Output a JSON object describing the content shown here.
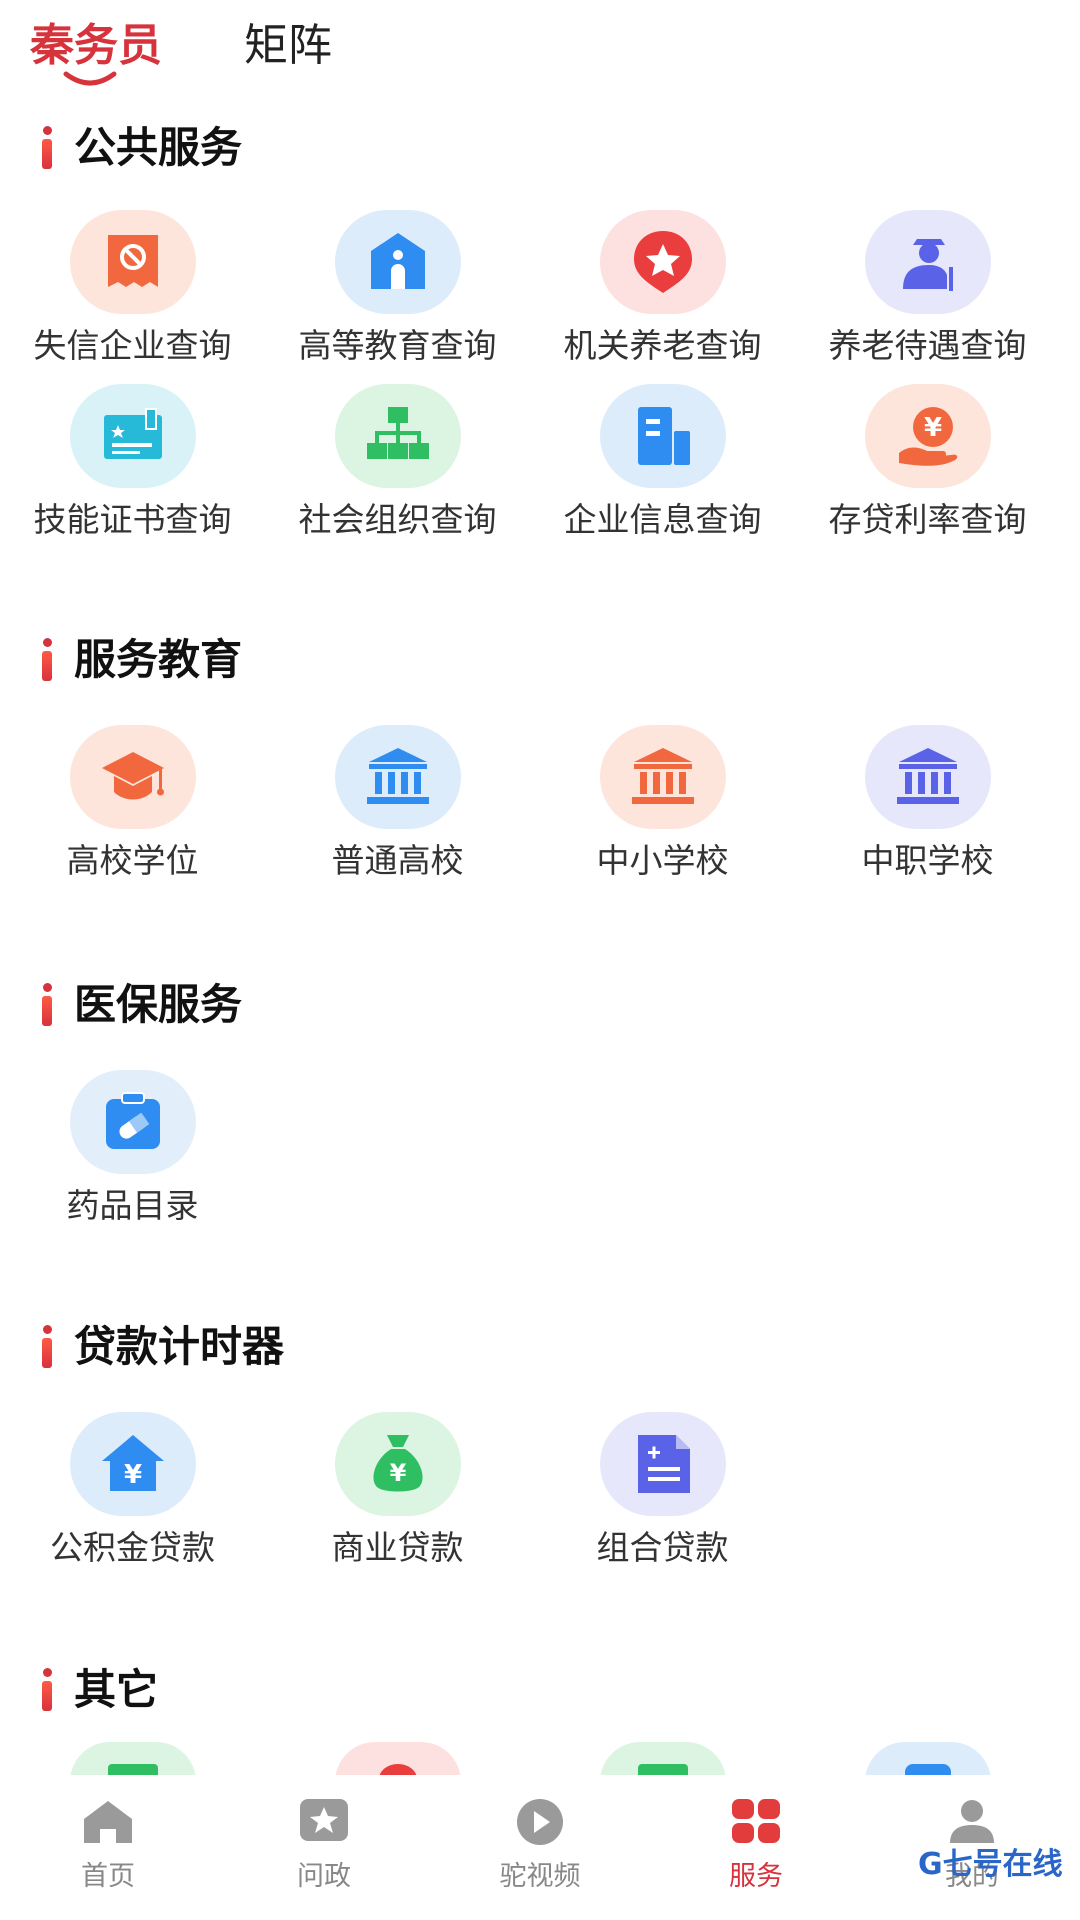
{
  "top_tabs": {
    "active": "秦务员",
    "inactive": "矩阵"
  },
  "sections": [
    {
      "title": "公共服务",
      "items": [
        {
          "label": "失信企业查询",
          "icon": "forbidden-doc-icon",
          "color": "#f2683e",
          "bg": "orange"
        },
        {
          "label": "高等教育查询",
          "icon": "school-building-icon",
          "color": "#2f8cf0",
          "bg": "blue"
        },
        {
          "label": "机关养老查询",
          "icon": "star-badge-icon",
          "color": "#ea3d3d",
          "bg": "red"
        },
        {
          "label": "养老待遇查询",
          "icon": "elder-person-icon",
          "color": "#5a63e8",
          "bg": "purple"
        },
        {
          "label": "技能证书查询",
          "icon": "certificate-icon",
          "color": "#27b9d8",
          "bg": "cyan"
        },
        {
          "label": "社会组织查询",
          "icon": "org-chart-icon",
          "color": "#2fbe62",
          "bg": "green"
        },
        {
          "label": "企业信息查询",
          "icon": "office-building-icon",
          "color": "#2f8cf0",
          "bg": "blue"
        },
        {
          "label": "存贷利率查询",
          "icon": "hand-coin-icon",
          "color": "#f2683e",
          "bg": "orange"
        }
      ]
    },
    {
      "title": "服务教育",
      "items": [
        {
          "label": "高校学位",
          "icon": "graduation-cap-icon",
          "color": "#f2683e",
          "bg": "orange"
        },
        {
          "label": "普通高校",
          "icon": "institution-icon",
          "color": "#2f8cf0",
          "bg": "blue"
        },
        {
          "label": "中小学校",
          "icon": "institution-icon",
          "color": "#f2683e",
          "bg": "orange"
        },
        {
          "label": "中职学校",
          "icon": "institution-icon",
          "color": "#5a63e8",
          "bg": "purple"
        }
      ]
    },
    {
      "title": "医保服务",
      "items": [
        {
          "label": "药品目录",
          "icon": "medicine-kit-icon",
          "color": "#2f8cf0",
          "bg": "lightblue"
        }
      ]
    },
    {
      "title": "贷款计时器",
      "items": [
        {
          "label": "公积金贷款",
          "icon": "house-yuan-icon",
          "color": "#2f8cf0",
          "bg": "blue"
        },
        {
          "label": "商业贷款",
          "icon": "money-bag-icon",
          "color": "#2fbe62",
          "bg": "green"
        },
        {
          "label": "组合贷款",
          "icon": "calculator-doc-icon",
          "color": "#5a63e8",
          "bg": "purple"
        }
      ]
    },
    {
      "title": "其它",
      "items": []
    }
  ],
  "bottom_nav": [
    {
      "label": "首页",
      "icon": "home-icon"
    },
    {
      "label": "问政",
      "icon": "star-chat-icon"
    },
    {
      "label": "驼视频",
      "icon": "play-icon"
    },
    {
      "label": "服务",
      "icon": "grid-apps-icon",
      "active": true
    },
    {
      "label": "我的",
      "icon": "user-icon"
    }
  ],
  "watermark": "G七号在线",
  "colors": {
    "accent": "#d6333d",
    "muted": "#888888"
  }
}
